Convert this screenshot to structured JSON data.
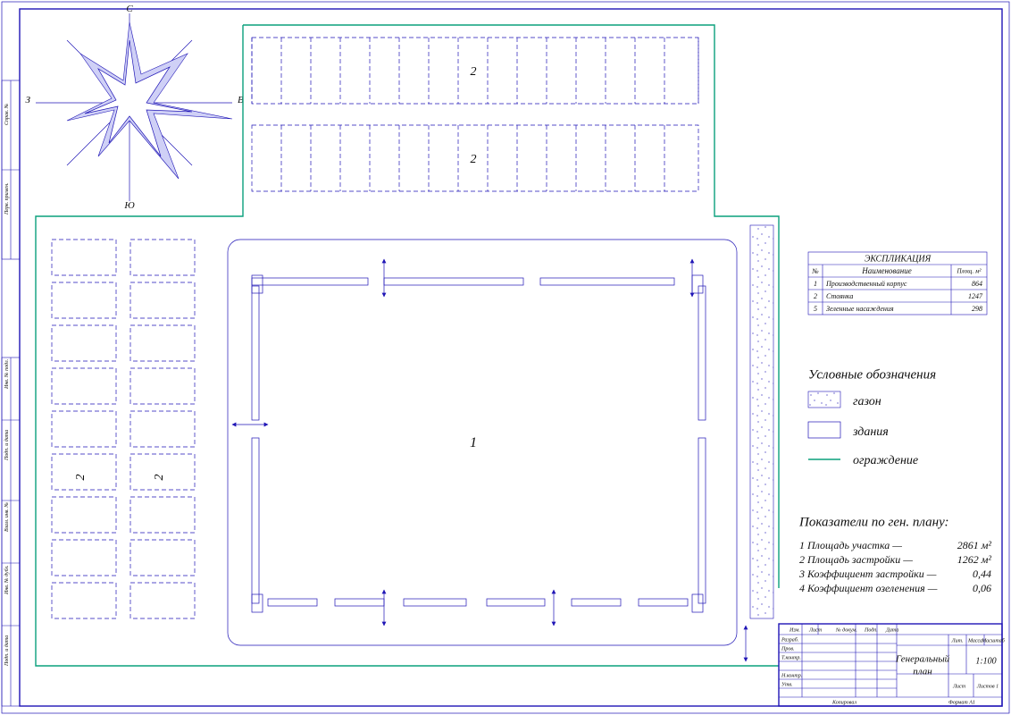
{
  "compass": {
    "n": "С",
    "s": "Ю",
    "e": "В",
    "w": "З"
  },
  "plan_labels": {
    "parking_top_a": "2",
    "parking_top_b": "2",
    "parking_left_a": "2",
    "parking_left_b": "2",
    "building": "1"
  },
  "explication": {
    "title": "ЭКСПЛИКАЦИЯ",
    "headers": {
      "no": "№",
      "name": "Наименование",
      "area": "Площ. м²"
    },
    "rows": [
      {
        "no": "1",
        "name": "Производственный корпус",
        "area": "864"
      },
      {
        "no": "2",
        "name": "Стоянка",
        "area": "1247"
      },
      {
        "no": "5",
        "name": "Зеленные насаждения",
        "area": "298"
      }
    ]
  },
  "legend": {
    "title": "Условные обозначения",
    "items": {
      "lawn": "газон",
      "buildings": "здания",
      "fence": "ограждение"
    }
  },
  "indicators": {
    "title": "Показатели по ген. плану:",
    "rows": [
      {
        "label": "1 Площадь участка —",
        "value": "2861 м²"
      },
      {
        "label": "2 Площадь застройки —",
        "value": "1262 м²"
      },
      {
        "label": "3 Коэффициент застройки —",
        "value": "0,44"
      },
      {
        "label": "4 Коэффициент озеленения —",
        "value": "0,06"
      }
    ]
  },
  "titleblock": {
    "doc_title_1": "Генеральный",
    "doc_title_2": "план",
    "scale": "1:100",
    "format": "Формат   А1",
    "kopiroval": "Копировал",
    "cols_top": {
      "lit": "Лит.",
      "massa": "Масса",
      "masshtab": "Масштаб"
    },
    "cols_bot": {
      "list": "Лист",
      "listov": "Листов  1"
    },
    "rows_left": [
      "Изм.",
      "Лист",
      "№ докум.",
      "Подп.",
      "Дата"
    ],
    "rows_side": [
      "Разраб.",
      "Пров.",
      "Т.контр.",
      "",
      "Н.контр.",
      "Утв."
    ]
  },
  "side_stamp": {
    "a": "Инв. № подл.",
    "b": "Подп. и дата",
    "c": "Взам. инв. №",
    "d": "Инв. № дубл.",
    "e": "Подп. и дата",
    "f": "Справ. №",
    "g": "Перв. примен."
  }
}
